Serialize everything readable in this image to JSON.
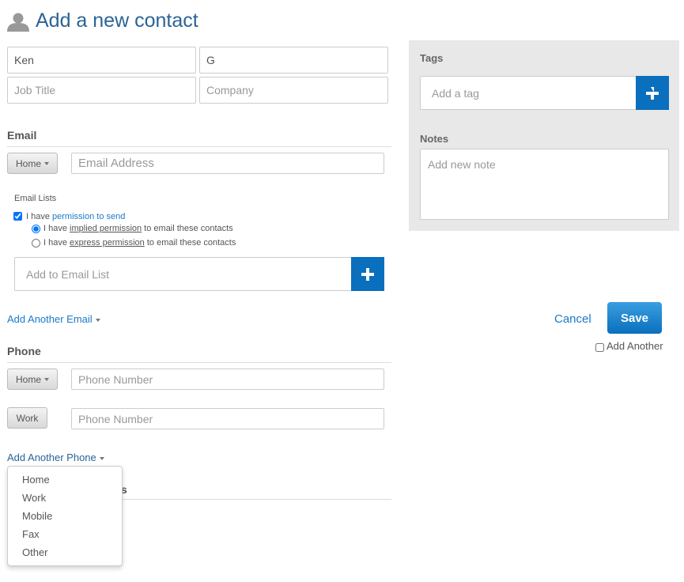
{
  "header": {
    "title": "Add a new contact",
    "icon": "person-icon"
  },
  "fields": {
    "first_name": "Ken",
    "last_name": "G",
    "job_title_placeholder": "Job Title",
    "company_placeholder": "Company"
  },
  "email": {
    "heading": "Email",
    "type": "Home",
    "placeholder": "Email Address",
    "lists_label": "Email Lists",
    "permission_prefix": "I have ",
    "permission_link": "permission to send",
    "implied": {
      "pre": "I have ",
      "link": "implied permission",
      "post": " to email these contacts",
      "selected": true
    },
    "express": {
      "pre": "I have ",
      "link": "express permission",
      "post": " to email these contacts",
      "selected": false
    },
    "permission_checked": true,
    "list_placeholder": "Add to Email List",
    "add_another": "Add Another Email"
  },
  "phone": {
    "heading": "Phone",
    "rows": [
      {
        "type": "Home",
        "placeholder": "Phone Number"
      },
      {
        "type": "Work",
        "placeholder": "Phone Number"
      }
    ],
    "add_another": "Add Another Phone",
    "menu": [
      "Home",
      "Work",
      "Mobile",
      "Fax",
      "Other"
    ]
  },
  "hidden_heading_fragment": "s",
  "side": {
    "tags_label": "Tags",
    "tag_placeholder": "Add a tag",
    "notes_label": "Notes",
    "notes_placeholder": "Add new note"
  },
  "actions": {
    "cancel": "Cancel",
    "save": "Save",
    "add_another": "Add Another",
    "add_another_checked": false
  },
  "colors": {
    "accent": "#0a6fbd",
    "title": "#2a6496",
    "link": "#1a7ac8"
  }
}
